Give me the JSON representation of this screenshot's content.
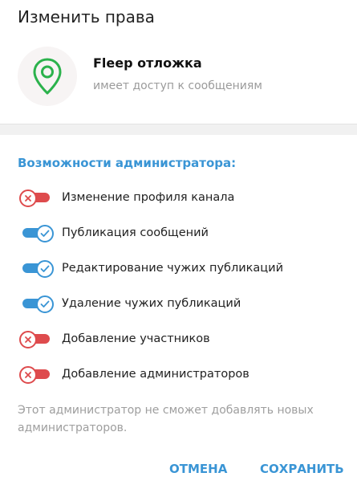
{
  "dialog": {
    "title": "Изменить права"
  },
  "bot": {
    "name": "Fleep отложка",
    "status": "имеет доступ к сообщениям",
    "avatar_icon": "map-pin-icon",
    "avatar_color": "#2bb24c"
  },
  "permissions": {
    "section_title": "Возможности администратора:",
    "items": [
      {
        "label": "Изменение профиля канала",
        "enabled": false
      },
      {
        "label": "Публикация сообщений",
        "enabled": true
      },
      {
        "label": "Редактирование чужих публикаций",
        "enabled": true
      },
      {
        "label": "Удаление чужих публикаций",
        "enabled": true
      },
      {
        "label": "Добавление участников",
        "enabled": false
      },
      {
        "label": "Добавление администраторов",
        "enabled": false
      }
    ]
  },
  "hint": "Этот администратор не сможет добавлять новых администраторов.",
  "actions": {
    "cancel_label": "ОТМЕНА",
    "save_label": "СОХРАНИТЬ"
  },
  "colors": {
    "accent": "#3a95d5",
    "off": "#de4b4d"
  }
}
